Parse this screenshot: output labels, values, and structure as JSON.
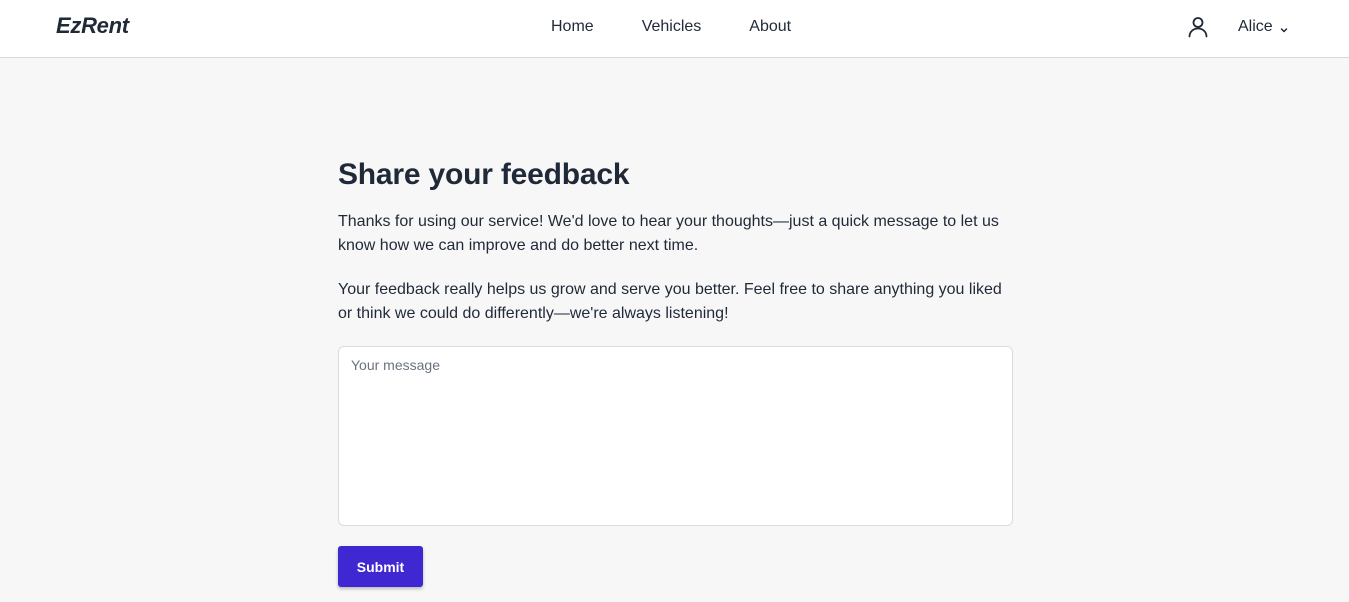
{
  "header": {
    "logo": "EzRent",
    "nav": [
      {
        "label": "Home"
      },
      {
        "label": "Vehicles"
      },
      {
        "label": "About"
      }
    ],
    "user": {
      "name": "Alice",
      "icon": "user-icon",
      "dropdown_icon": "chevron-down-icon"
    }
  },
  "main": {
    "title": "Share your feedback",
    "paragraphs": [
      "Thanks for using our service! We'd love to hear your thoughts—just a quick message to let us know how we can improve and do better next time.",
      "Your feedback really helps us grow and serve you better. Feel free to share anything you liked or think we could do differently—we're always listening!"
    ],
    "message": {
      "value": "",
      "placeholder": "Your message"
    },
    "submit_label": "Submit"
  },
  "colors": {
    "background": "#f7f7f7",
    "header_bg": "#ffffff",
    "text": "#1f2937",
    "accent": "#3f27d1"
  }
}
